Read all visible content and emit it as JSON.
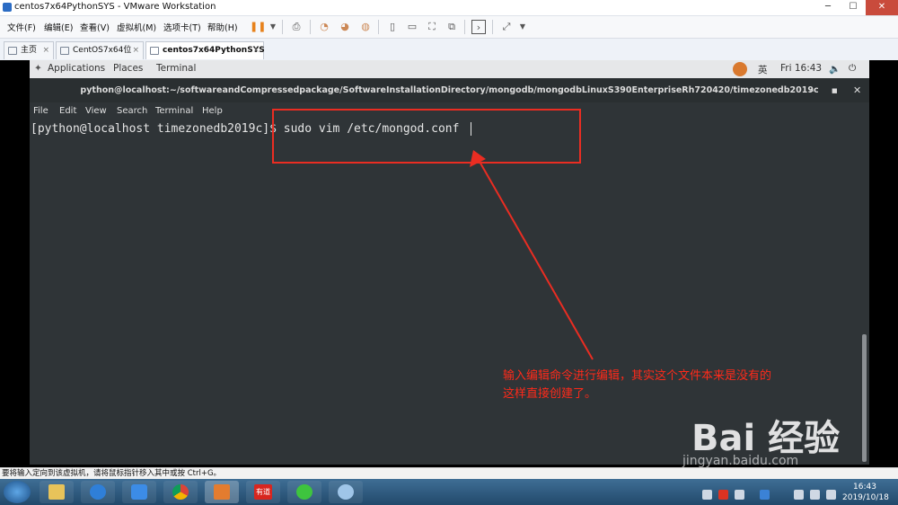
{
  "vmware": {
    "window_title": "centos7x64PythonSYS - VMware Workstation",
    "menu": [
      "文件(F)",
      "编辑(E)",
      "查看(V)",
      "虚拟机(M)",
      "选项卡(T)",
      "帮助(H)"
    ],
    "tabs": [
      {
        "label": "主页"
      },
      {
        "label": "CentOS7x64位"
      },
      {
        "label": "centos7x64PythonSYS"
      }
    ],
    "status_text": "要将输入定向到该虚拟机，请将鼠标指针移入其中或按 Ctrl+G。"
  },
  "gnome": {
    "applications": "Applications",
    "places": "Places",
    "terminal": "Terminal",
    "input_method": "英",
    "clock": "Fri 16:43"
  },
  "terminal": {
    "title": "python@localhost:~/softwareandCompressedpackage/SoftwareInstallationDirectory/mongodb/mongodbLinuxS390EnterpriseRh720420/timezonedb2019c",
    "menu": [
      "File",
      "Edit",
      "View",
      "Search",
      "Terminal",
      "Help"
    ],
    "prompt": "[python@localhost timezonedb2019c]$ sudo vim /etc/mongod.conf"
  },
  "annotation": {
    "line1": "输入编辑命令进行编辑，其实这个文件本来是没有的",
    "line2": "这样直接创建了。",
    "color": "#ea2d22"
  },
  "watermark": {
    "brand": "Bai 经验",
    "url": "jingyan.baidu.com"
  },
  "taskbar": {
    "time": "16:43",
    "date": "2019/10/18",
    "apps": [
      "start-icon",
      "file-explorer-icon",
      "media-player-icon",
      "blue-app-icon",
      "chrome-icon",
      "vmware-icon",
      "youdao-icon",
      "wechat-icon",
      "paint-icon"
    ],
    "youdao_label": "有道"
  }
}
